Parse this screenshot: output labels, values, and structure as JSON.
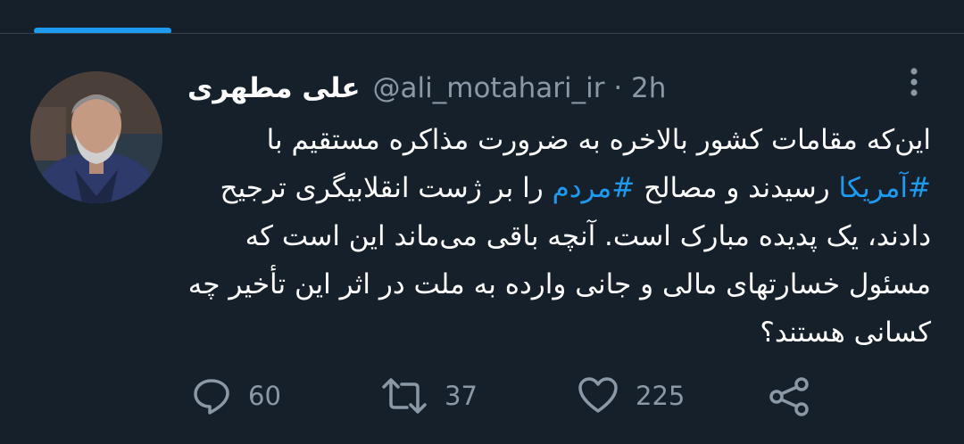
{
  "tweet": {
    "display_name": "علی مطهری",
    "handle": "@ali_motahari_ir",
    "separator": "·",
    "time": "2h",
    "text_part1": "این‌که مقامات کشور بالاخره به ضرورت مذاکره مستقیم با ",
    "hashtag1": "#آمریکا",
    "text_part2": " رسیدند و مصالح ",
    "hashtag2": "#مردم",
    "text_part3": " را بر ژست انقلابیگری ترجیح دادند، یک پدیده مبارک است. آنچه باقی می‌ماند این است که مسئول خسارتهای مالی و جانی وارده به ملت در اثر این تأخیر چه کسانی هستند؟"
  },
  "actions": {
    "reply_count": "60",
    "retweet_count": "37",
    "like_count": "225"
  },
  "colors": {
    "background": "#15202b",
    "accent": "#1d9bf0",
    "secondary_text": "#8b98a5"
  },
  "icons": [
    "reply-icon",
    "retweet-icon",
    "like-icon",
    "share-icon",
    "more-options-icon"
  ]
}
